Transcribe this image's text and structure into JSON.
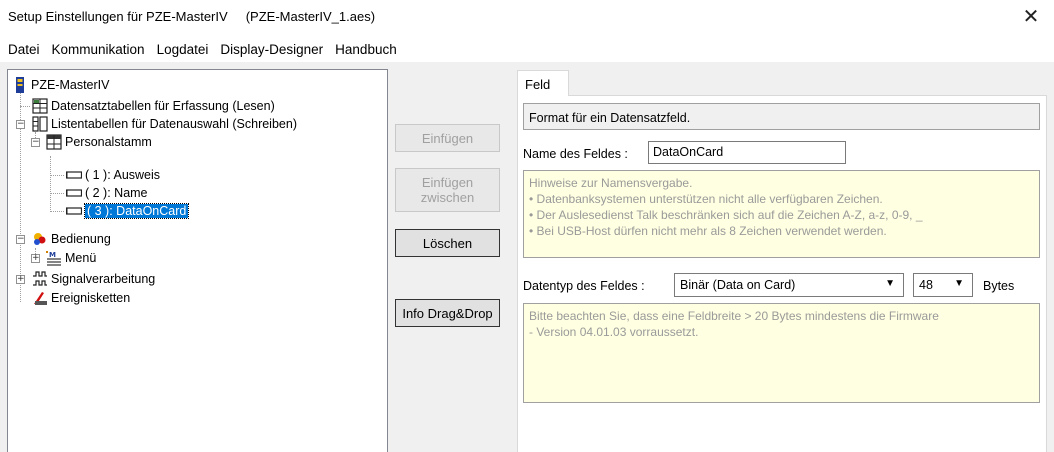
{
  "window": {
    "title": "Setup Einstellungen für PZE-MasterIV     (PZE-MasterIV_1.aes)",
    "close_glyph": "✕"
  },
  "menu": [
    "Datei",
    "Kommunikation",
    "Logdatei",
    "Display-Designer",
    "Handbuch"
  ],
  "tree": {
    "root": "PZE-MasterIV",
    "datensatz": "Datensatztabellen für Erfassung (Lesen)",
    "listen": "Listentabellen für Datenauswahl (Schreiben)",
    "personalstamm": "Personalstamm",
    "field1": "( 1 ): Ausweis",
    "field2": "( 2 ): Name",
    "field3": "( 3 ): DataOnCard",
    "bedienung": "Bedienung",
    "menue": "Menü",
    "signal": "Signalverarbeitung",
    "ereignis": "Ereignisketten",
    "expanded_glyph": "−",
    "collapsed_glyph": "+"
  },
  "buttons": {
    "einfuegen": "Einfügen",
    "einfuegen_zwischen_1": "Einfügen",
    "einfuegen_zwischen_2": "zwischen",
    "loeschen": "Löschen",
    "info_dragdrop": "Info Drag&Drop"
  },
  "tab": {
    "label": "Feld"
  },
  "panel": {
    "format_text": "Format für ein Datensatzfeld.",
    "name_label": "Name des Feldes :",
    "name_value": "DataOnCard",
    "hint_lines": [
      "Hinweise zur Namensvergabe.",
      "• Datenbanksystemen unterstützen nicht alle verfügbaren Zeichen.",
      "• Der Auslesedienst Talk beschränken sich auf die Zeichen A-Z, a-z, 0-9, _",
      "• Bei USB-Host dürfen nicht mehr als 8 Zeichen verwendet werden."
    ],
    "datatype_label": "Datentyp des Feldes :",
    "datatype_value": "Binär (Data on Card)",
    "size_value": "48",
    "bytes_label": "Bytes",
    "note_lines": [
      "Bitte beachten Sie, dass eine Feldbreite > 20 Bytes mindestens die Firmware",
      "- Version 04.01.03 vorraussetzt."
    ],
    "dropdown_glyph": "▼"
  },
  "colors": {
    "selection": "#0078d7",
    "hint_bg": "#ffffe1"
  }
}
